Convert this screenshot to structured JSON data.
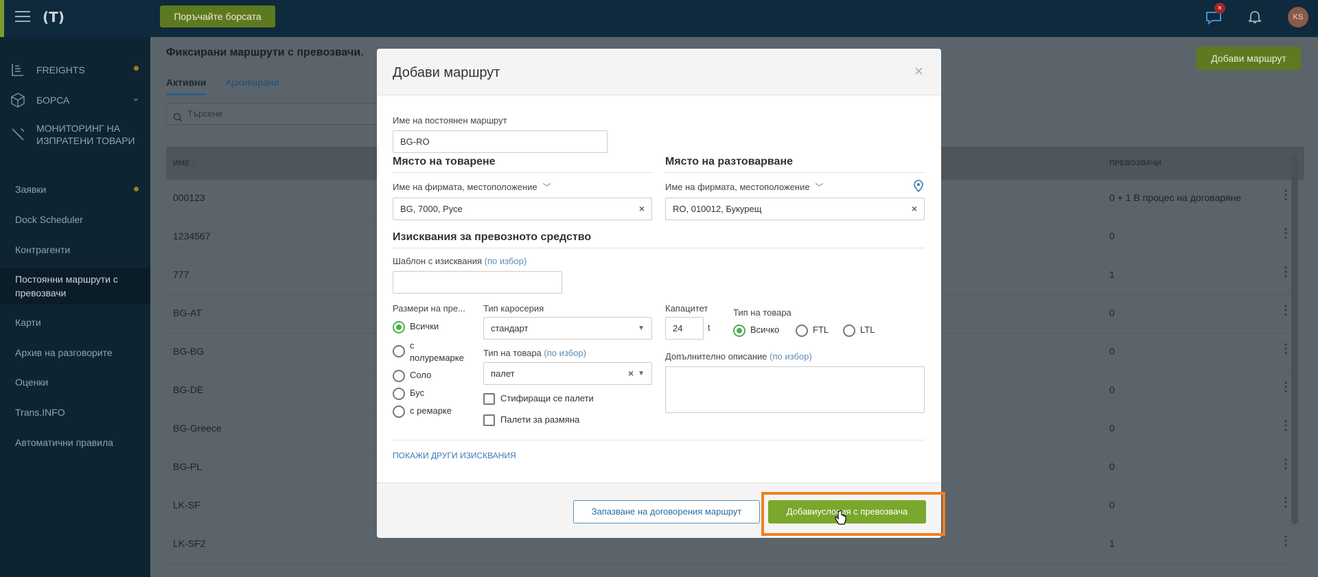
{
  "topbar": {
    "logo": "(T)",
    "cta_button": "Поръчайте борсата",
    "notif_badge": "×",
    "avatar_initials": "KS"
  },
  "sidebar": {
    "main_nav": [
      {
        "label": "FREIGHTS",
        "icon": "freights-icon"
      },
      {
        "label": "БОРСА",
        "icon": "cube-icon"
      },
      {
        "label": "МОНИТОРИНГ НА ИЗПРАТЕНИ ТОВАРИ",
        "icon": "satellite-icon"
      }
    ],
    "items": [
      "Заявки",
      "Dock Scheduler",
      "Контрагенти",
      "Постоянни маршрути с превозвачи",
      "Карти",
      "Архив на разговорите",
      "Оценки",
      "Trans.INFO",
      "Автоматични правила"
    ],
    "active_item": "Постоянни маршрути с превозвачи"
  },
  "page": {
    "title": "Фиксирани маршрути с превозвачи.",
    "add_route_button": "Добави маршрут",
    "tabs": [
      "Активни",
      "Архивирани"
    ],
    "search_placeholder": "Търсене",
    "columns": {
      "name": "ИМЕ ↑",
      "carriers": "ПРЕВОЗВАЧИ"
    },
    "rows": [
      {
        "name": "000123",
        "carriers": "0 + 1 В процес на договаряне"
      },
      {
        "name": "1234567",
        "carriers": "0"
      },
      {
        "name": "777",
        "carriers": "1"
      },
      {
        "name": "BG-AT",
        "carriers": "0"
      },
      {
        "name": "BG-BG",
        "carriers": "0"
      },
      {
        "name": "BG-DE",
        "carriers": "0"
      },
      {
        "name": "BG-Greece",
        "carriers": "0"
      },
      {
        "name": "BG-PL",
        "carriers": "0"
      },
      {
        "name": "LK-SF",
        "carriers": "0"
      },
      {
        "name": "LK-SF2",
        "carriers": "1"
      }
    ]
  },
  "modal": {
    "title": "Добави маршрут",
    "route_name_label": "Име на постоянен маршрут",
    "route_name_value": "BG-RO",
    "loading_title": "Място на товарене",
    "loading_picker": "Име на фирмата, местоположение",
    "loading_value": "BG, 7000, Русе",
    "unloading_title": "Място на разтоварване",
    "unloading_picker": "Име на фирмата, местоположение",
    "unloading_value": "RO, 010012, Букурещ",
    "vehicle_title": "Изисквания за превозното средство",
    "template_label": "Шаблон с изисквания",
    "optional": "(по избор)",
    "size_label": "Размери на пре...",
    "size_options": [
      "Всички",
      "с полуремарке",
      "Соло",
      "Бус",
      "с ремарке"
    ],
    "body_type_label": "Тип каросерия",
    "body_type_value": "стандарт",
    "cargo_type_label": "Тип на товара",
    "cargo_type_value": "палет",
    "stackable": "Стифиращи се палети",
    "exchange": "Палети за размяна",
    "capacity_label": "Капацитет",
    "capacity_value": "24",
    "capacity_unit": "t",
    "goods_type_label": "Тип на товара",
    "goods_options": [
      "Всичко",
      "FTL",
      "LTL"
    ],
    "extra_desc_label": "Допълнително описание",
    "more_link": "ПОКАЖИ ДРУГИ ИЗИСКВАНИЯ",
    "save_button": "Запазване на договорения маршрут",
    "add_terms_button": "Добавиусловия с превозвача"
  }
}
